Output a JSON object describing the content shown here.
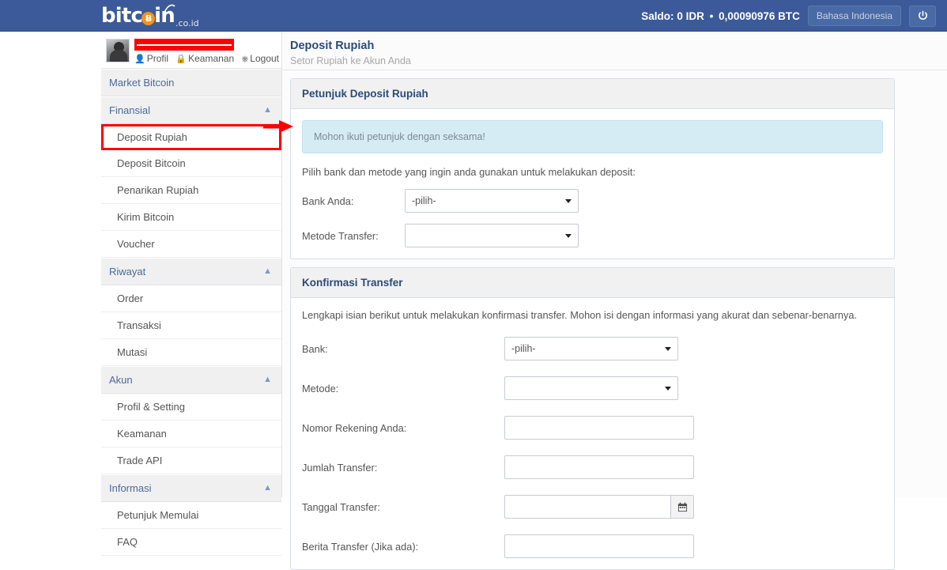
{
  "navbar": {
    "brand": {
      "text_before": "bitc",
      "coin": "Ƀ",
      "text_after": "in",
      "suffix": ".co.id"
    },
    "saldo_label": "Saldo:",
    "saldo_idr": "0 IDR",
    "separator": "•",
    "saldo_btc": "0,00090976 BTC",
    "language_button": "Bahasa Indonesia",
    "logout_icon": "power-icon",
    "background_color": "#3c5a99"
  },
  "sidebar": {
    "username_redacted": "",
    "profile_links": [
      {
        "icon": "user-icon",
        "label": "Profil"
      },
      {
        "icon": "lock-icon",
        "label": "Keamanan"
      },
      {
        "icon": "power-icon",
        "label": "Logout"
      }
    ],
    "sections": [
      {
        "type": "head",
        "label": "Market Bitcoin",
        "chevron": false
      },
      {
        "type": "head",
        "label": "Finansial",
        "chevron": true
      },
      {
        "type": "item",
        "label": "Deposit Rupiah",
        "highlighted": true
      },
      {
        "type": "item",
        "label": "Deposit Bitcoin",
        "highlighted": false
      },
      {
        "type": "item",
        "label": "Penarikan Rupiah",
        "highlighted": false
      },
      {
        "type": "item",
        "label": "Kirim Bitcoin",
        "highlighted": false
      },
      {
        "type": "item",
        "label": "Voucher",
        "highlighted": false
      },
      {
        "type": "head",
        "label": "Riwayat",
        "chevron": true
      },
      {
        "type": "item",
        "label": "Order",
        "highlighted": false
      },
      {
        "type": "item",
        "label": "Transaksi",
        "highlighted": false
      },
      {
        "type": "item",
        "label": "Mutasi",
        "highlighted": false
      },
      {
        "type": "head",
        "label": "Akun",
        "chevron": true
      },
      {
        "type": "item",
        "label": "Profil & Setting",
        "highlighted": false
      },
      {
        "type": "item",
        "label": "Keamanan",
        "highlighted": false
      },
      {
        "type": "item",
        "label": "Trade API",
        "highlighted": false
      },
      {
        "type": "head",
        "label": "Informasi",
        "chevron": true
      },
      {
        "type": "item",
        "label": "Petunjuk Memulai",
        "highlighted": false
      },
      {
        "type": "item",
        "label": "FAQ",
        "highlighted": false
      }
    ],
    "highlight_color": "#fe0000"
  },
  "page": {
    "title": "Deposit Rupiah",
    "subtitle": "Setor Rupiah ke Akun Anda"
  },
  "panel_petunjuk": {
    "heading": "Petunjuk Deposit Rupiah",
    "alert": "Mohon ikuti petunjuk dengan seksama!",
    "instruction": "Pilih bank dan metode yang ingin anda gunakan untuk melakukan deposit:",
    "fields": [
      {
        "label": "Bank Anda:",
        "type": "select",
        "value": "-pilih-"
      },
      {
        "label": "Metode Transfer:",
        "type": "select",
        "value": ""
      }
    ]
  },
  "panel_konfirmasi": {
    "heading": "Konfirmasi Transfer",
    "description": "Lengkapi isian berikut untuk melakukan konfirmasi transfer. Mohon isi dengan informasi yang akurat dan sebenar-benarnya.",
    "fields": [
      {
        "label": "Bank:",
        "type": "select",
        "value": "-pilih-"
      },
      {
        "label": "Metode:",
        "type": "select",
        "value": ""
      },
      {
        "label": "Nomor Rekening Anda:",
        "type": "text",
        "value": ""
      },
      {
        "label": "Jumlah Transfer:",
        "type": "text",
        "value": ""
      },
      {
        "label": "Tanggal Transfer:",
        "type": "date",
        "value": "",
        "button_icon": "calendar-icon"
      },
      {
        "label": "Berita Transfer (Jika ada):",
        "type": "text",
        "value": ""
      }
    ]
  },
  "annotation": {
    "arrow_color": "#fe0000",
    "arrow_points_to": "Mohon ikuti petunjuk dengan seksama!"
  }
}
